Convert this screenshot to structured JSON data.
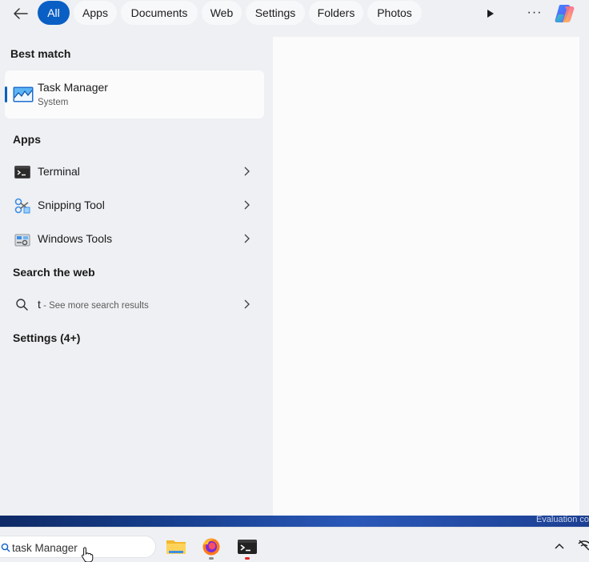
{
  "filters": {
    "tabs": [
      {
        "label": "All",
        "active": true
      },
      {
        "label": "Apps",
        "active": false
      },
      {
        "label": "Documents",
        "active": false
      },
      {
        "label": "Web",
        "active": false
      },
      {
        "label": "Settings",
        "active": false
      },
      {
        "label": "Folders",
        "active": false
      },
      {
        "label": "Photos",
        "active": false
      }
    ],
    "icons": [
      "back-arrow-icon",
      "play-icon",
      "more-icon",
      "copilot-icon"
    ],
    "more_label": "···"
  },
  "best_match": {
    "heading": "Best match",
    "title": "Task Manager",
    "subtitle": "System",
    "icon": "task-manager-icon"
  },
  "apps": {
    "heading": "Apps",
    "items": [
      {
        "label": "Terminal",
        "icon": "terminal-icon"
      },
      {
        "label": "Snipping Tool",
        "icon": "snipping-tool-icon"
      },
      {
        "label": "Windows Tools",
        "icon": "windows-tools-icon"
      }
    ]
  },
  "web": {
    "heading": "Search the web",
    "query": "t",
    "hint": " - See more search results",
    "icon": "search-icon"
  },
  "settings": {
    "heading": "Settings (4+)"
  },
  "desktop": {
    "watermark": "Evaluation co"
  },
  "taskbar": {
    "search_value": "task Manager",
    "apps": [
      "file-explorer-icon",
      "firefox-icon",
      "terminal-icon"
    ]
  },
  "colors": {
    "accent": "#0a5fc4",
    "pane": "#eef0f3",
    "card": "#fbfbfc"
  }
}
